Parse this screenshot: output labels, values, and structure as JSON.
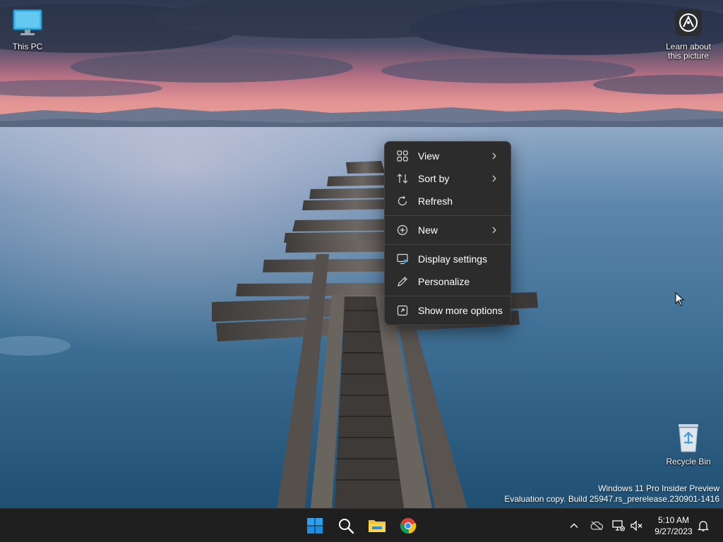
{
  "desktop": {
    "icons": [
      {
        "label": "This PC",
        "icon": "monitor-icon"
      },
      {
        "label": "Learn about this picture",
        "icon": "camera-help-icon"
      },
      {
        "label": "Recycle Bin",
        "icon": "recycle-bin-icon"
      }
    ],
    "watermark": {
      "line1": "Windows 11 Pro Insider Preview",
      "line2": "Evaluation copy. Build 25947.rs_prerelease.230901-1416"
    }
  },
  "context_menu": {
    "items": [
      {
        "label": "View",
        "icon": "grid-view-icon",
        "submenu": true
      },
      {
        "label": "Sort by",
        "icon": "sort-icon",
        "submenu": true
      },
      {
        "label": "Refresh",
        "icon": "refresh-icon",
        "submenu": false
      },
      {
        "label": "New",
        "icon": "plus-circle-icon",
        "submenu": true
      },
      {
        "label": "Display settings",
        "icon": "display-settings-icon",
        "submenu": false
      },
      {
        "label": "Personalize",
        "icon": "pen-icon",
        "submenu": false
      },
      {
        "label": "Show more options",
        "icon": "expand-icon",
        "submenu": false
      }
    ]
  },
  "taskbar": {
    "apps": [
      "windows-start-icon",
      "search-icon",
      "file-explorer-icon",
      "chrome-icon"
    ],
    "tray": [
      "chevron-up-icon",
      "onedrive-icon",
      "network-icon",
      "speaker-muted-icon",
      "notification-bell-icon"
    ],
    "clock": {
      "time": "5:10 AM",
      "date": "9/27/2023"
    }
  },
  "colors": {
    "taskbar_bg": "#1f1f1f",
    "menu_bg": "#2c2c2c",
    "accent": "#0078d4"
  }
}
